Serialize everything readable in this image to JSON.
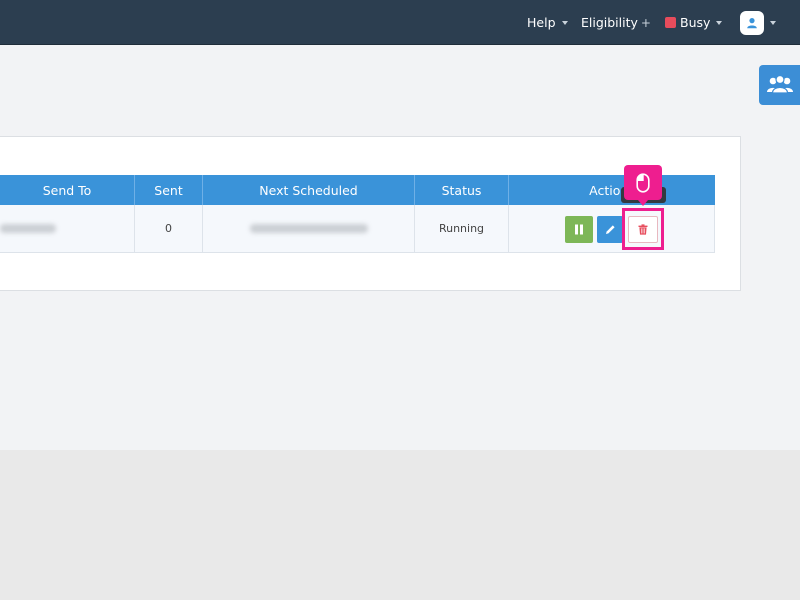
{
  "nav": {
    "help_label": "Help",
    "eligibility_label": "Eligibility",
    "eligibility_plus": "+",
    "status_label": "Busy",
    "status_color": "#e74c5c"
  },
  "table": {
    "columns": [
      "Send To",
      "Sent",
      "Next Scheduled",
      "Status",
      "Actions"
    ],
    "rows": [
      {
        "sent": "0",
        "status": "Running"
      }
    ]
  },
  "actions": {
    "pause": "pause-icon",
    "edit": "pencil-icon",
    "delete": "trash-icon"
  },
  "colors": {
    "topbar": "#2c3e50",
    "table_header": "#3a93d9",
    "pause_button": "#7db757",
    "edit_button": "#3a93d9",
    "delete_icon": "#e74c5c",
    "highlight": "#ee1e8f"
  }
}
